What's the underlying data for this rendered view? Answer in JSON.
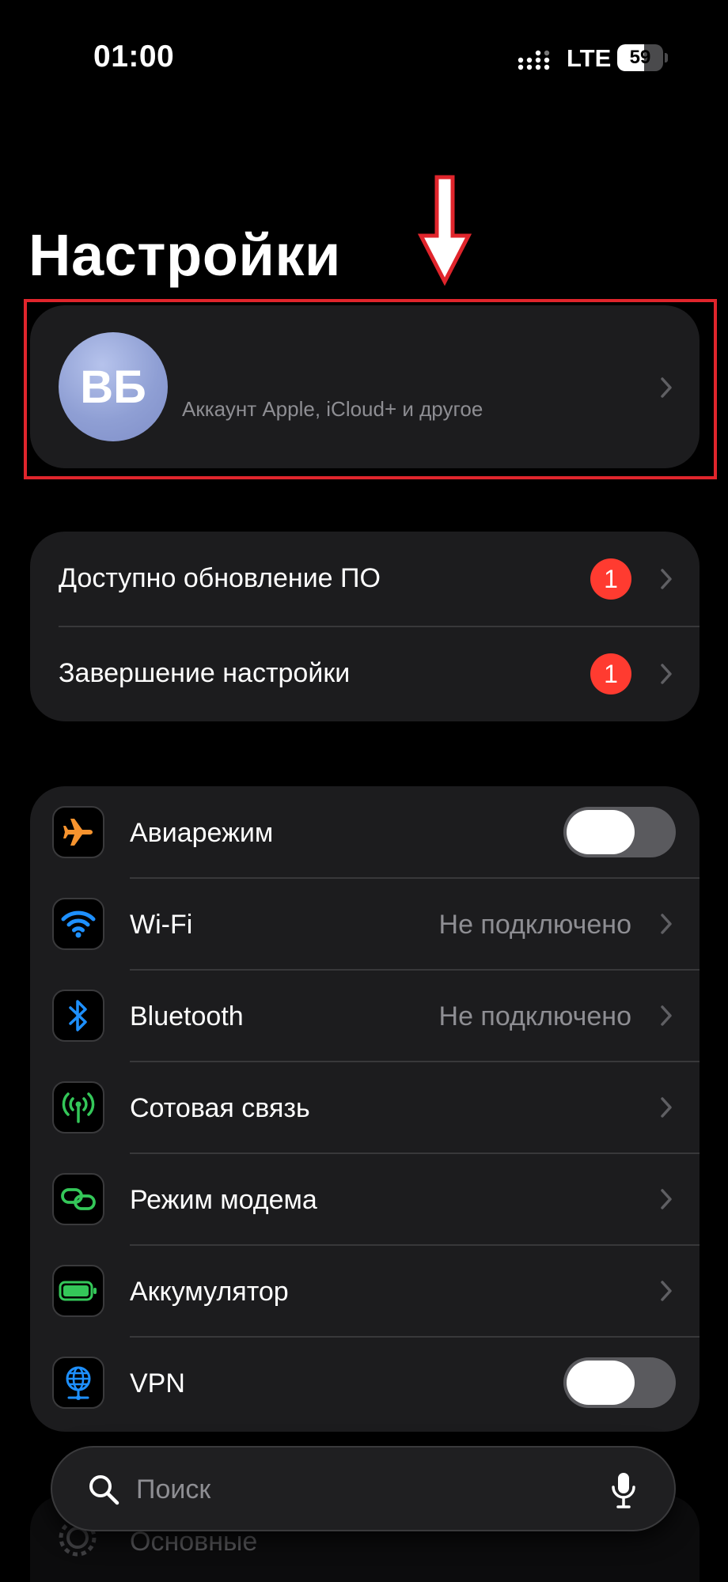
{
  "status_bar": {
    "time": "01:00",
    "network": "LTE",
    "battery_level": "59",
    "battery_fraction": 0.59,
    "icons": [
      "signal-icon",
      "battery-icon"
    ]
  },
  "title": "Настройки",
  "account": {
    "initials": "ВБ",
    "subtitle": "Аккаунт Apple, iCloud+ и другое"
  },
  "alerts": [
    {
      "label": "Доступно обновление ПО",
      "badge": "1"
    },
    {
      "label": "Завершение настройки",
      "badge": "1"
    }
  ],
  "connectivity": [
    {
      "label": "Авиарежим",
      "icon": "airplane-icon",
      "control": "toggle",
      "on": false
    },
    {
      "label": "Wi-Fi",
      "icon": "wifi-icon",
      "value": "Не подключено"
    },
    {
      "label": "Bluetooth",
      "icon": "bluetooth-icon",
      "value": "Не подключено"
    },
    {
      "label": "Сотовая связь",
      "icon": "cellular-icon"
    },
    {
      "label": "Режим модема",
      "icon": "hotspot-icon"
    },
    {
      "label": "Аккумулятор",
      "icon": "battery-icon"
    },
    {
      "label": "VPN",
      "icon": "vpn-globe-icon",
      "control": "toggle",
      "on": false
    }
  ],
  "general_partial": {
    "label": "Основные",
    "icon": "gear-icon"
  },
  "search": {
    "placeholder": "Поиск"
  },
  "colors": {
    "background": "#000000",
    "card": "#1c1c1e",
    "badge": "#ff3b30",
    "annotation": "#e0252c",
    "secondary_text": "#8e8e93",
    "airplane": "#f7932e",
    "wifi": "#1e90ff",
    "green": "#34c759"
  }
}
